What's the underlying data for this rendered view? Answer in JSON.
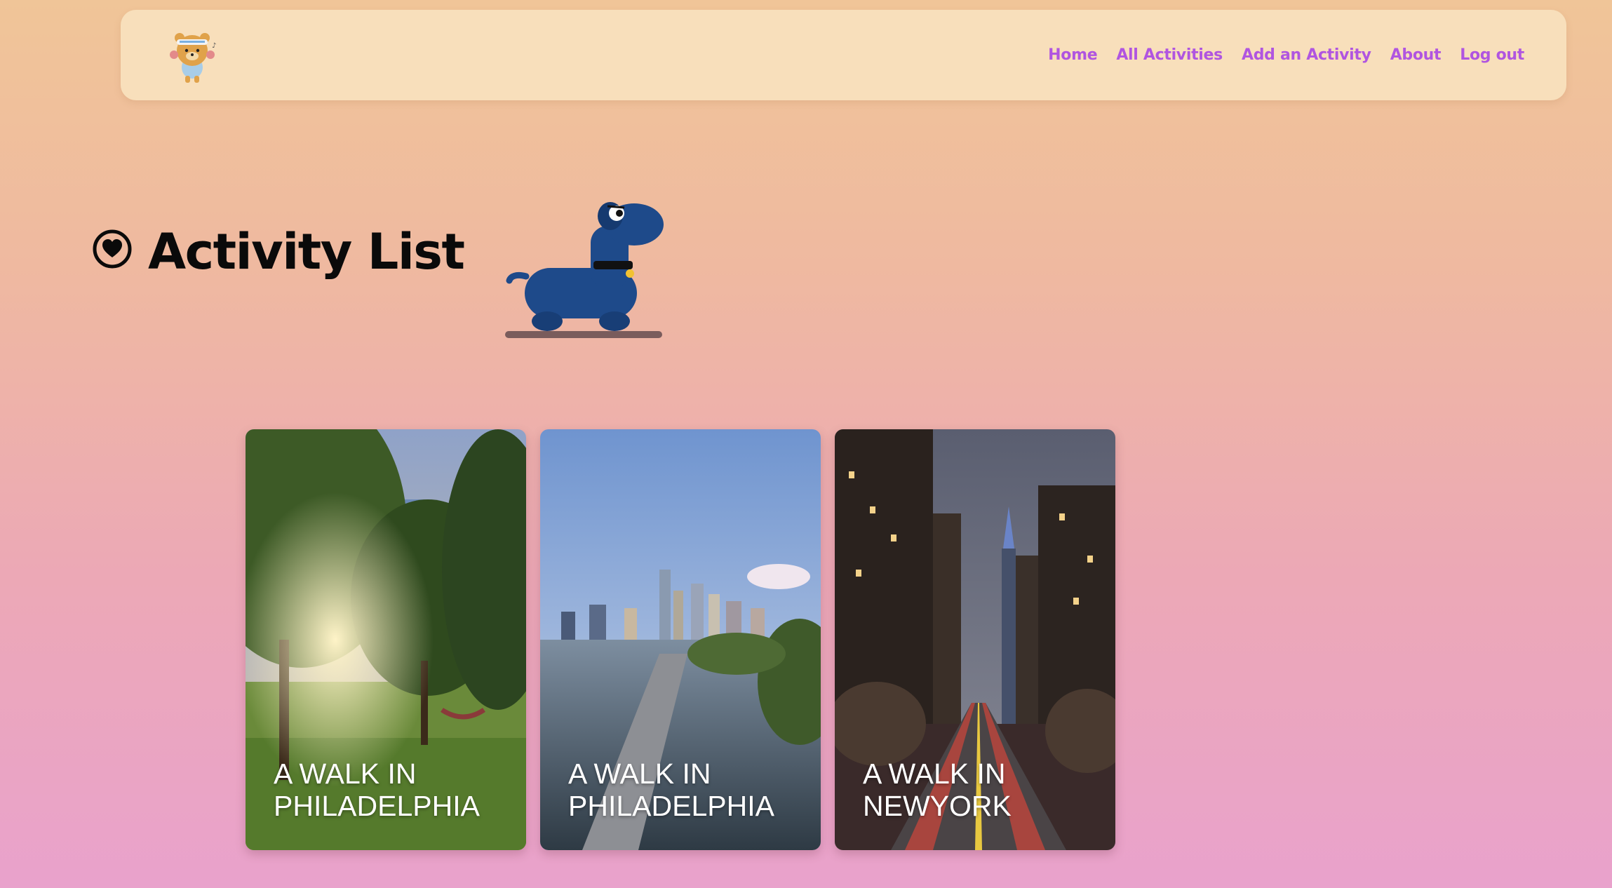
{
  "nav": {
    "logo_icon": "bear-mascot-icon",
    "links": [
      {
        "label": "Home"
      },
      {
        "label": "All Activities"
      },
      {
        "label": "Add an Activity"
      },
      {
        "label": "About"
      },
      {
        "label": "Log out"
      }
    ],
    "link_color": "#b055e0",
    "background": "#f8dfbb"
  },
  "header": {
    "icon": "heart-circle-icon",
    "title": "Activity List",
    "illustration": "blue-dog-walking-icon"
  },
  "activities": [
    {
      "title": "A WALK IN PHILADELPHIA",
      "image": "park-sunset-trees-hammock"
    },
    {
      "title": "A WALK IN PHILADELPHIA",
      "image": "river-skyline-boardwalk"
    },
    {
      "title": "A WALK IN NEWYORK",
      "image": "city-street-night-skyscrapers"
    }
  ],
  "colors": {
    "bg_top": "#f0c598",
    "bg_bottom": "#e9a2cc",
    "title": "#0a0a0a",
    "dog": "#1e4a8a"
  }
}
